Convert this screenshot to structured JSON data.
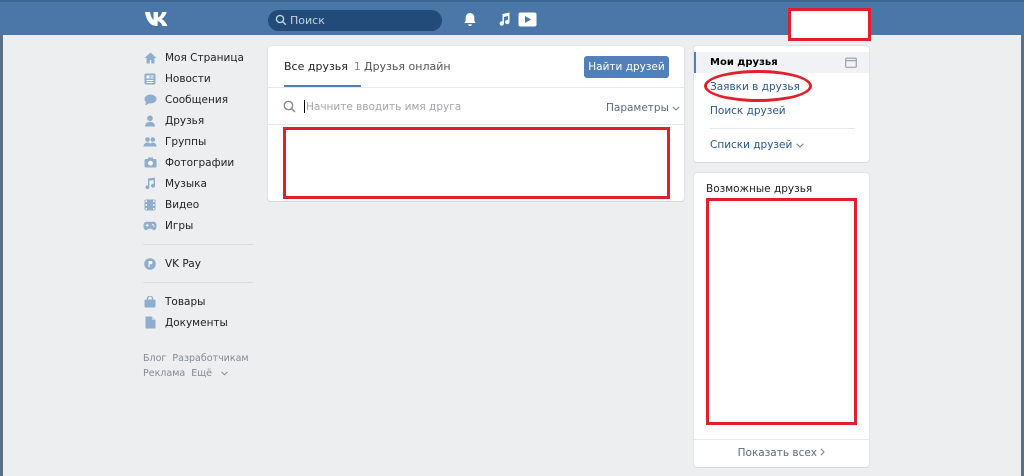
{
  "header": {
    "logo": "VK",
    "search_placeholder": "Поиск",
    "icons": [
      "notifications-bell-icon",
      "music-note-icon",
      "video-play-icon"
    ],
    "colors": {
      "bar": "#4a76a8",
      "search": "#224b7a"
    }
  },
  "nav": {
    "items": [
      {
        "label": "Моя Страница",
        "icon": "home-icon"
      },
      {
        "label": "Новости",
        "icon": "news-icon"
      },
      {
        "label": "Сообщения",
        "icon": "messages-icon"
      },
      {
        "label": "Друзья",
        "icon": "friends-icon"
      },
      {
        "label": "Группы",
        "icon": "groups-icon"
      },
      {
        "label": "Фотографии",
        "icon": "photos-icon"
      },
      {
        "label": "Музыка",
        "icon": "music-icon"
      },
      {
        "label": "Видео",
        "icon": "video-icon"
      },
      {
        "label": "Игры",
        "icon": "games-icon"
      }
    ],
    "vkpay": "VK Pay",
    "extra": [
      {
        "label": "Товары",
        "icon": "goods-icon"
      },
      {
        "label": "Документы",
        "icon": "documents-icon"
      }
    ],
    "footer": [
      "Блог",
      "Разработчикам",
      "Реклама",
      "Ещё"
    ]
  },
  "main": {
    "tab_all": "Все друзья",
    "tab_all_count": "1",
    "tab_online": "Друзья онлайн",
    "find_button": "Найти друзей",
    "search_placeholder": "Начните вводить имя друга",
    "params_label": "Параметры"
  },
  "right": {
    "my_friends": "Мои друзья",
    "requests": "Заявки в друзья",
    "search_friends": "Поиск друзей",
    "lists": "Списки друзей",
    "possible_title": "Возможные друзья",
    "show_all": "Показать всех"
  },
  "colors": {
    "accent": "#5181b8",
    "annotation": "#e0202c",
    "background": "#edeef0"
  }
}
